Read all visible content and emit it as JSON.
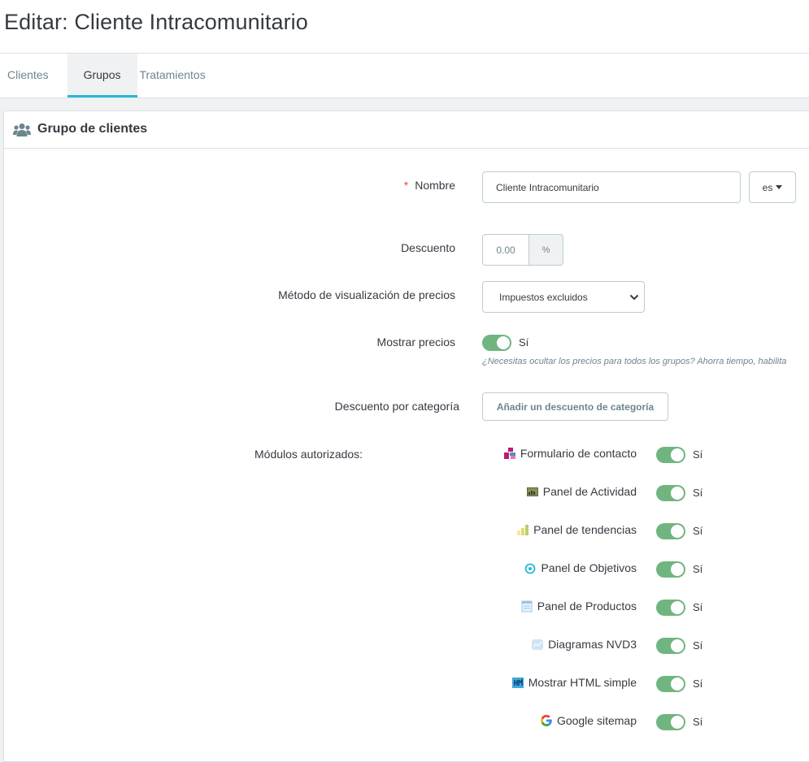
{
  "page": {
    "title": "Editar: Cliente Intracomunitario",
    "tabs": [
      {
        "label": "Clientes",
        "active": false
      },
      {
        "label": "Grupos",
        "active": true
      },
      {
        "label": "Tratamientos",
        "active": false
      }
    ]
  },
  "card": {
    "title": "Grupo de clientes",
    "icon": "users-icon"
  },
  "form": {
    "name": {
      "required_mark": "*",
      "label": "Nombre",
      "value": "Cliente Intracomunitario",
      "lang": "es"
    },
    "discount": {
      "label": "Descuento",
      "value": "0.00",
      "unit": "%"
    },
    "price_display": {
      "label": "Método de visualización de precios",
      "selected": "Impuestos excluidos"
    },
    "show_prices": {
      "label": "Mostrar precios",
      "state": "Sí",
      "help": "¿Necesitas ocultar los precios para todos los grupos? Ahorra tiempo, habilita"
    },
    "category_discount": {
      "label": "Descuento por categoría",
      "button": "Añadir un descuento de categoría"
    },
    "modules": {
      "label": "Módulos autorizados:",
      "items": [
        {
          "label": "Formulario de contacto",
          "state": "Sí",
          "icon": "contact-form-icon"
        },
        {
          "label": "Panel de Actividad",
          "state": "Sí",
          "icon": "activity-panel-icon"
        },
        {
          "label": "Panel de tendencias",
          "state": "Sí",
          "icon": "trends-panel-icon"
        },
        {
          "label": "Panel de Objetivos",
          "state": "Sí",
          "icon": "goals-panel-icon"
        },
        {
          "label": "Panel de Productos",
          "state": "Sí",
          "icon": "products-panel-icon"
        },
        {
          "label": "Diagramas NVD3",
          "state": "Sí",
          "icon": "nvd3-charts-icon"
        },
        {
          "label": "Mostrar HTML simple",
          "state": "Sí",
          "icon": "html-block-icon"
        },
        {
          "label": "Google sitemap",
          "state": "Sí",
          "icon": "google-icon"
        }
      ]
    }
  },
  "colors": {
    "accent": "#25b9d7",
    "switch_on": "#70b580",
    "required": "#e54c3d"
  }
}
